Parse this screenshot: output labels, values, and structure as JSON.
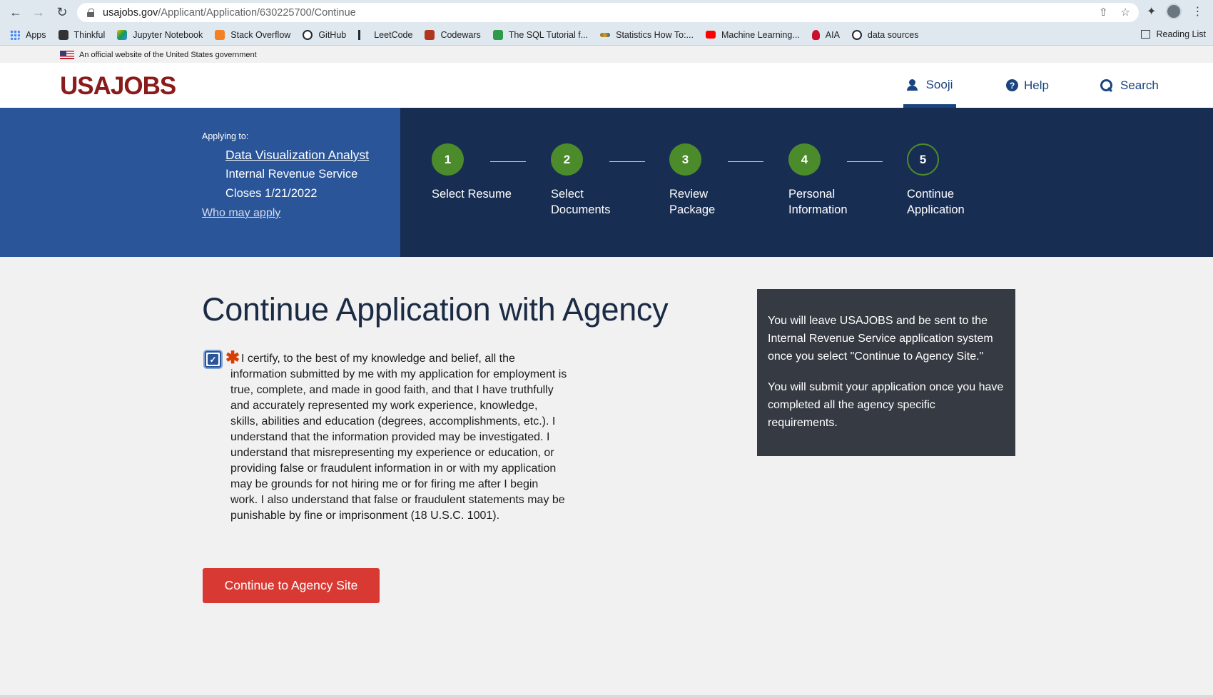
{
  "browser": {
    "url_host": "usajobs.gov",
    "url_path": "/Applicant/Application/630225700/Continue",
    "bookmarks": [
      {
        "label": "Apps",
        "color": "#4285f4"
      },
      {
        "label": "Thinkful",
        "color": "#333333"
      },
      {
        "label": "Jupyter Notebook",
        "color": "#f4b400"
      },
      {
        "label": "Stack Overflow",
        "color": "#f48024"
      },
      {
        "label": "GitHub",
        "color": "#24292e"
      },
      {
        "label": "LeetCode",
        "color": "#ffa116"
      },
      {
        "label": "Codewars",
        "color": "#b1361e"
      },
      {
        "label": "The SQL Tutorial f...",
        "color": "#2e9b4a"
      },
      {
        "label": "Statistics How To:...",
        "color": "#8a6d3b"
      },
      {
        "label": "Machine Learning...",
        "color": "#ff0000"
      },
      {
        "label": "AIA",
        "color": "#c8102e"
      },
      {
        "label": "data sources",
        "color": "#24292e"
      }
    ],
    "reading_list": "Reading List"
  },
  "gov_banner": "An official website of the United States government",
  "header": {
    "logo": "USAJOBS",
    "user": "Sooji",
    "help": "Help",
    "search": "Search"
  },
  "apply": {
    "label": "Applying to:",
    "job_title": "Data Visualization Analyst",
    "agency": "Internal Revenue Service",
    "closes": "Closes 1/21/2022",
    "who_may_apply": "Who may apply"
  },
  "steps": [
    {
      "num": "1",
      "label": "Select Resume"
    },
    {
      "num": "2",
      "label": "Select Documents"
    },
    {
      "num": "3",
      "label": "Review Package"
    },
    {
      "num": "4",
      "label": "Personal Information"
    },
    {
      "num": "5",
      "label": "Continue Application"
    }
  ],
  "main": {
    "title": "Continue Application with Agency",
    "certification": "I certify, to the best of my knowledge and belief, all the information submitted by me with my application for employment is true, complete, and made in good faith, and that I have truthfully and accurately represented my work experience, knowledge, skills, abilities and education (degrees, accomplishments, etc.). I understand that the information provided may be investigated. I understand that misrepresenting my experience or education, or providing false or fraudulent information in or with my application may be grounds for not hiring me or for firing me after I begin work. I also understand that false or fraudulent statements may be punishable by fine or imprisonment (18 U.S.C. 1001).",
    "continue_button": "Continue to Agency Site"
  },
  "info_box": {
    "para1": "You will leave USAJOBS and be sent to the Internal Revenue Service application system once you select \"Continue to Agency Site.\"",
    "para2": "You will submit your application once you have completed all the agency specific requirements."
  }
}
